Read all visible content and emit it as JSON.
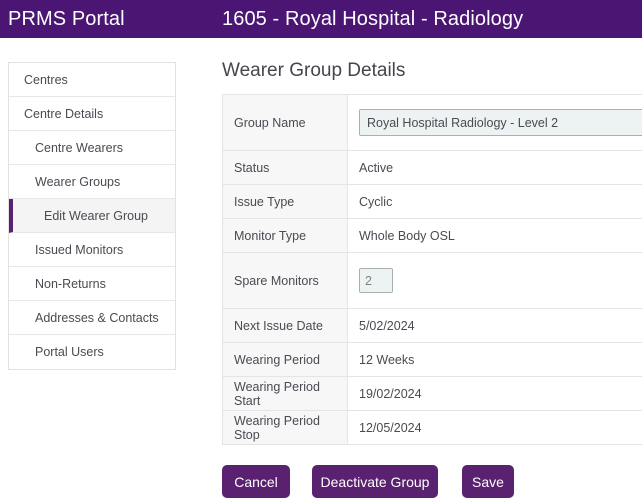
{
  "header": {
    "brand": "PRMS Portal",
    "context": "1605 - Royal Hospital - Radiology"
  },
  "sidebar": {
    "items": [
      {
        "label": "Centres",
        "level": 1,
        "active": false
      },
      {
        "label": "Centre Details",
        "level": 1,
        "active": false
      },
      {
        "label": "Centre Wearers",
        "level": 2,
        "active": false
      },
      {
        "label": "Wearer Groups",
        "level": 2,
        "active": false
      },
      {
        "label": "Edit Wearer Group",
        "level": 3,
        "active": true
      },
      {
        "label": "Issued Monitors",
        "level": 2,
        "active": false
      },
      {
        "label": "Non-Returns",
        "level": 2,
        "active": false
      },
      {
        "label": "Addresses & Contacts",
        "level": 2,
        "active": false
      },
      {
        "label": "Portal Users",
        "level": 2,
        "active": false
      }
    ]
  },
  "main": {
    "title": "Wearer Group Details",
    "rows": {
      "group_name": {
        "label": "Group Name",
        "value": "Royal Hospital Radiology - Level 2"
      },
      "status": {
        "label": "Status",
        "value": "Active"
      },
      "issue_type": {
        "label": "Issue Type",
        "value": "Cyclic"
      },
      "monitor_type": {
        "label": "Monitor Type",
        "value": "Whole Body OSL"
      },
      "spare_monitors": {
        "label": "Spare Monitors",
        "value": "2"
      },
      "next_issue_date": {
        "label": "Next Issue Date",
        "value": "5/02/2024"
      },
      "wearing_period": {
        "label": "Wearing Period",
        "value": "12 Weeks"
      },
      "wearing_period_start": {
        "label": "Wearing Period Start",
        "value": "19/02/2024"
      },
      "wearing_period_stop": {
        "label": "Wearing Period Stop",
        "value": "12/05/2024"
      }
    }
  },
  "actions": {
    "cancel": "Cancel",
    "deactivate": "Deactivate Group",
    "save": "Save"
  },
  "colors": {
    "header_purple": "#4b1574",
    "button_purple": "#5b2171",
    "input_fill": "#ecf3f2",
    "label_cell": "#f7f7f7",
    "active_nav_bg": "#f4f4f4"
  }
}
